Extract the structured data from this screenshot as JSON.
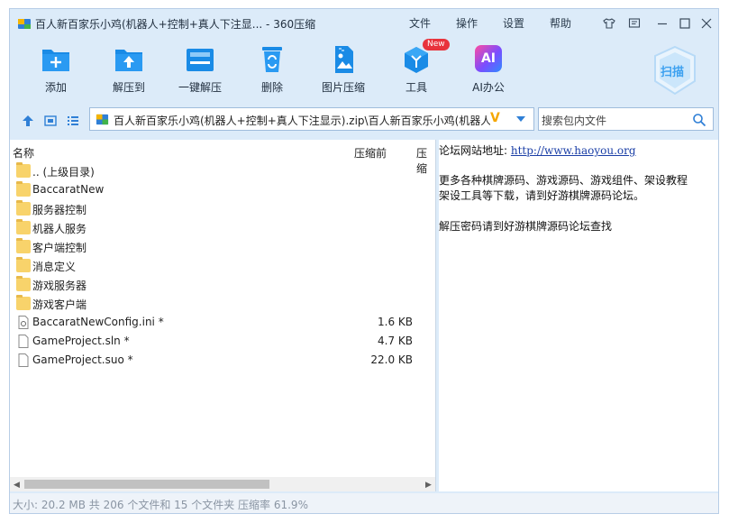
{
  "window": {
    "title": "百人新百家乐小鸡(机器人+控制+真人下注显... - 360压缩",
    "menus": [
      "文件",
      "操作",
      "设置",
      "帮助"
    ]
  },
  "toolbar": {
    "add": "添加",
    "extract_to": "解压到",
    "one_click_extract": "一键解压",
    "delete": "删除",
    "image_compress": "图片压缩",
    "tools": "工具",
    "tools_badge": "New",
    "ai_office": "AI办公",
    "ai_icon_text": "AI",
    "scan": "扫描"
  },
  "address": {
    "path": "百人新百家乐小鸡(机器人+控制+真人下注显示).zip\\百人新百家乐小鸡(机器人+",
    "v_mark": "V",
    "search_placeholder": "搜索包内文件"
  },
  "list": {
    "col_name": "名称",
    "col_before": "压缩前",
    "col_after": "压缩",
    "rows": [
      {
        "name": ".. (上级目录)",
        "size": "",
        "type": "folder"
      },
      {
        "name": "BaccaratNew",
        "size": "",
        "type": "folder"
      },
      {
        "name": "服务器控制",
        "size": "",
        "type": "folder"
      },
      {
        "name": "机器人服务",
        "size": "",
        "type": "folder"
      },
      {
        "name": "客户端控制",
        "size": "",
        "type": "folder"
      },
      {
        "name": "消息定义",
        "size": "",
        "type": "folder"
      },
      {
        "name": "游戏服务器",
        "size": "",
        "type": "folder"
      },
      {
        "name": "游戏客户端",
        "size": "",
        "type": "folder"
      },
      {
        "name": "BaccaratNewConfig.ini *",
        "size": "1.6 KB",
        "type": "ini"
      },
      {
        "name": "GameProject.sln *",
        "size": "4.7 KB",
        "type": "file"
      },
      {
        "name": "GameProject.suo *",
        "size": "22.0 KB",
        "type": "file"
      }
    ]
  },
  "preview": {
    "forum_label": "论坛网站地址:",
    "forum_url": "http://www.haoyou.org",
    "more_line1": "更多各种棋牌源码、游戏源码、游戏组件、架设教程",
    "more_line2": "架设工具等下载，请到好游棋牌源码论坛。",
    "password_line": "解压密码请到好游棋牌源码论坛查找"
  },
  "status": {
    "text": "大小: 20.2 MB 共 206 个文件和 15 个文件夹 压缩率 61.9%"
  },
  "colors": {
    "accent": "#1a8be6",
    "window_bg": "#dcebf9",
    "badge_red": "#e8333c",
    "folder": "#f8d36b"
  }
}
